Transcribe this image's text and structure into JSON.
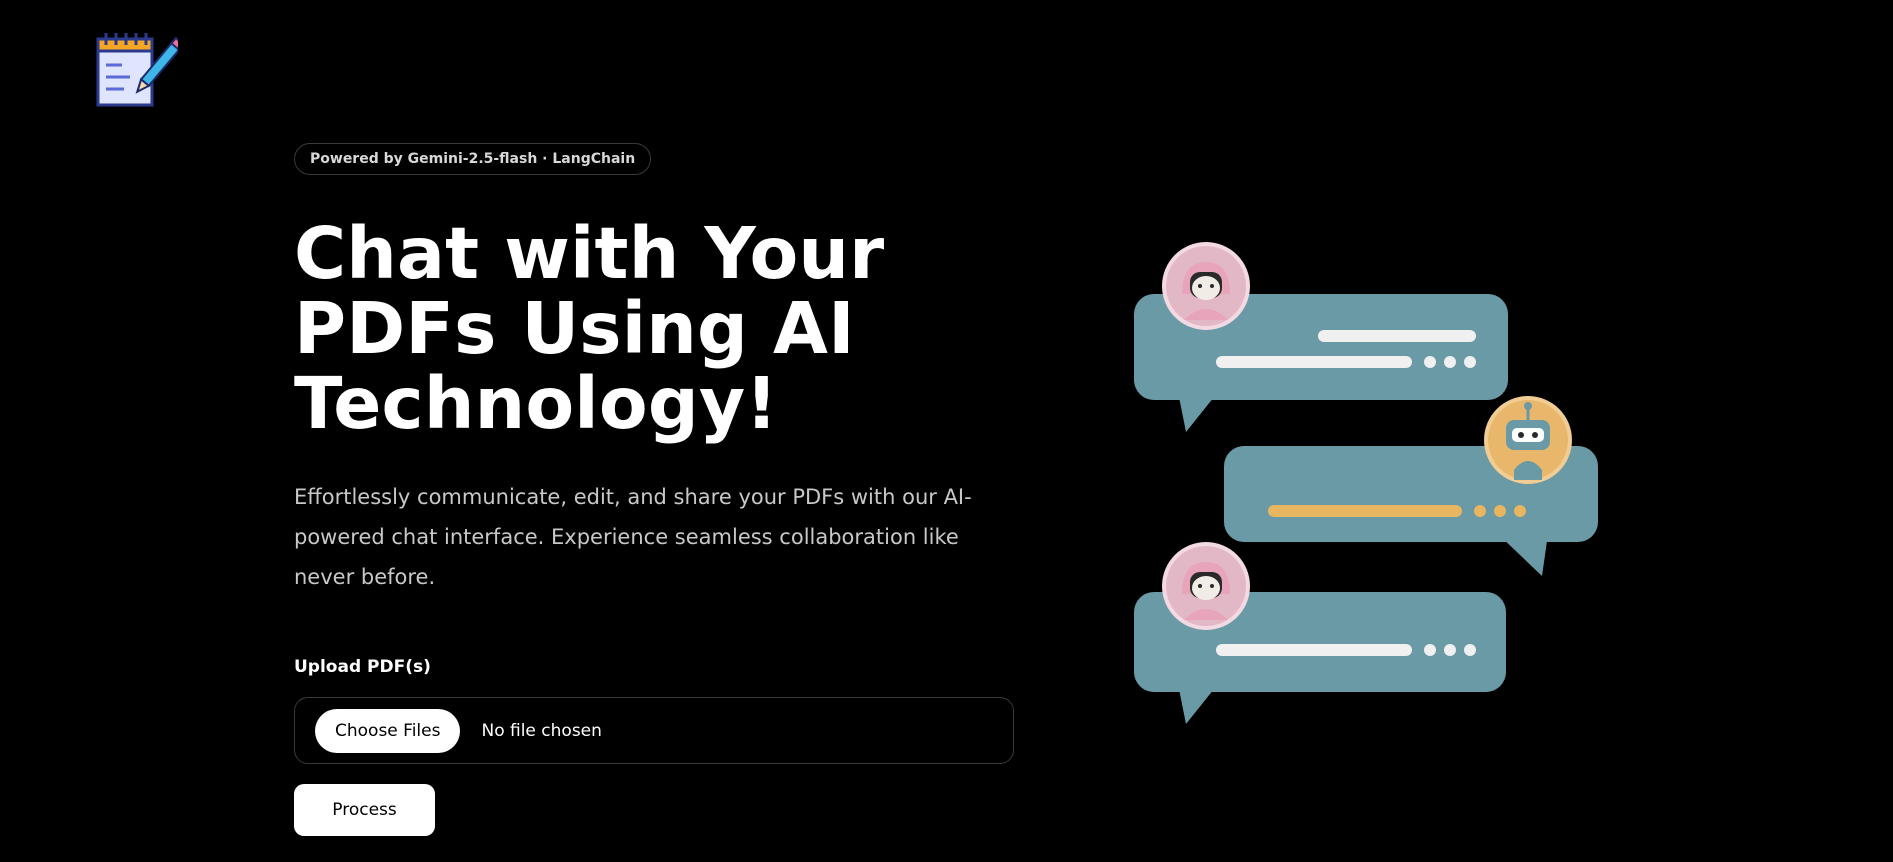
{
  "header": {
    "logo_icon": "notepad-pencil-icon"
  },
  "hero": {
    "badge": "Powered by Gemini-2.5-flash · LangChain",
    "title": "Chat with Your PDFs Using AI Technology!",
    "subtitle": "Effortlessly communicate, edit, and share your PDFs with our AI-powered chat interface. Experience seamless collaboration like never before."
  },
  "upload": {
    "label": "Upload PDF(s)",
    "choose_button": "Choose Files",
    "file_status": "No file chosen",
    "process_button": "Process"
  },
  "illustration": {
    "icon": "chat-bubbles-illustration",
    "colors": {
      "bubble": "#6b9aa7",
      "avatar_user": "#e3b8c6",
      "avatar_bot": "#e8b76b",
      "line_white": "#f0f0f0",
      "line_orange": "#e8b560"
    }
  },
  "theme": {
    "background": "#000000",
    "text": "#ffffff",
    "muted_text": "#c8c8c8",
    "border": "#3a3a3a"
  }
}
